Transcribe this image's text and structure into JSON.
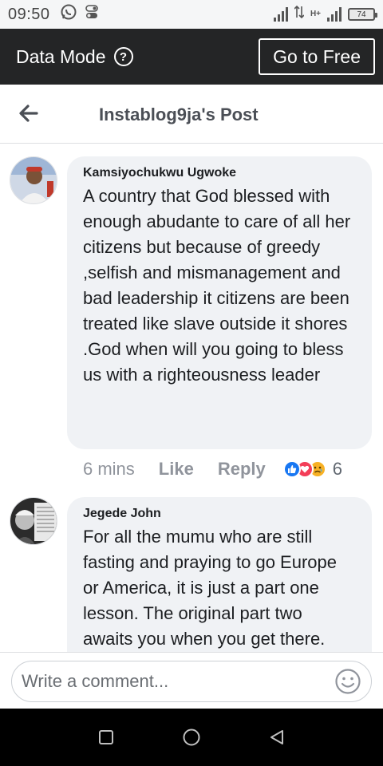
{
  "status_bar": {
    "time": "09:50",
    "network_label": "H+",
    "battery_level": "74"
  },
  "data_mode": {
    "label": "Data Mode",
    "help_icon": "?",
    "button_label": "Go to Free"
  },
  "header": {
    "title": "Instablog9ja's Post"
  },
  "comments": [
    {
      "author": "Kamsiyochukwu Ugwoke",
      "text": "A country that God blessed with enough abudante to care of all her citizens but because of greedy ,selfish and mismanagement and bad leadership it citizens are been treated like slave outside it shores .God when will you going to bless us with a righteousness leader",
      "time": "6 mins",
      "like_label": "Like",
      "reply_label": "Reply",
      "reactions": [
        "like-icon",
        "love-icon",
        "sad-icon"
      ],
      "reaction_count": "6"
    },
    {
      "author": "Jegede John",
      "text": "For all the mumu who are still fasting and praying to go Europe or America, it is just a part one lesson. The original part two awaits you when you get there."
    }
  ],
  "composer": {
    "placeholder": "Write a comment..."
  },
  "colors": {
    "dark_bar": "#242526",
    "bubble": "#f0f2f5",
    "like_blue": "#1877f2",
    "love_red": "#f33e58",
    "sad_yellow": "#f7b125"
  }
}
